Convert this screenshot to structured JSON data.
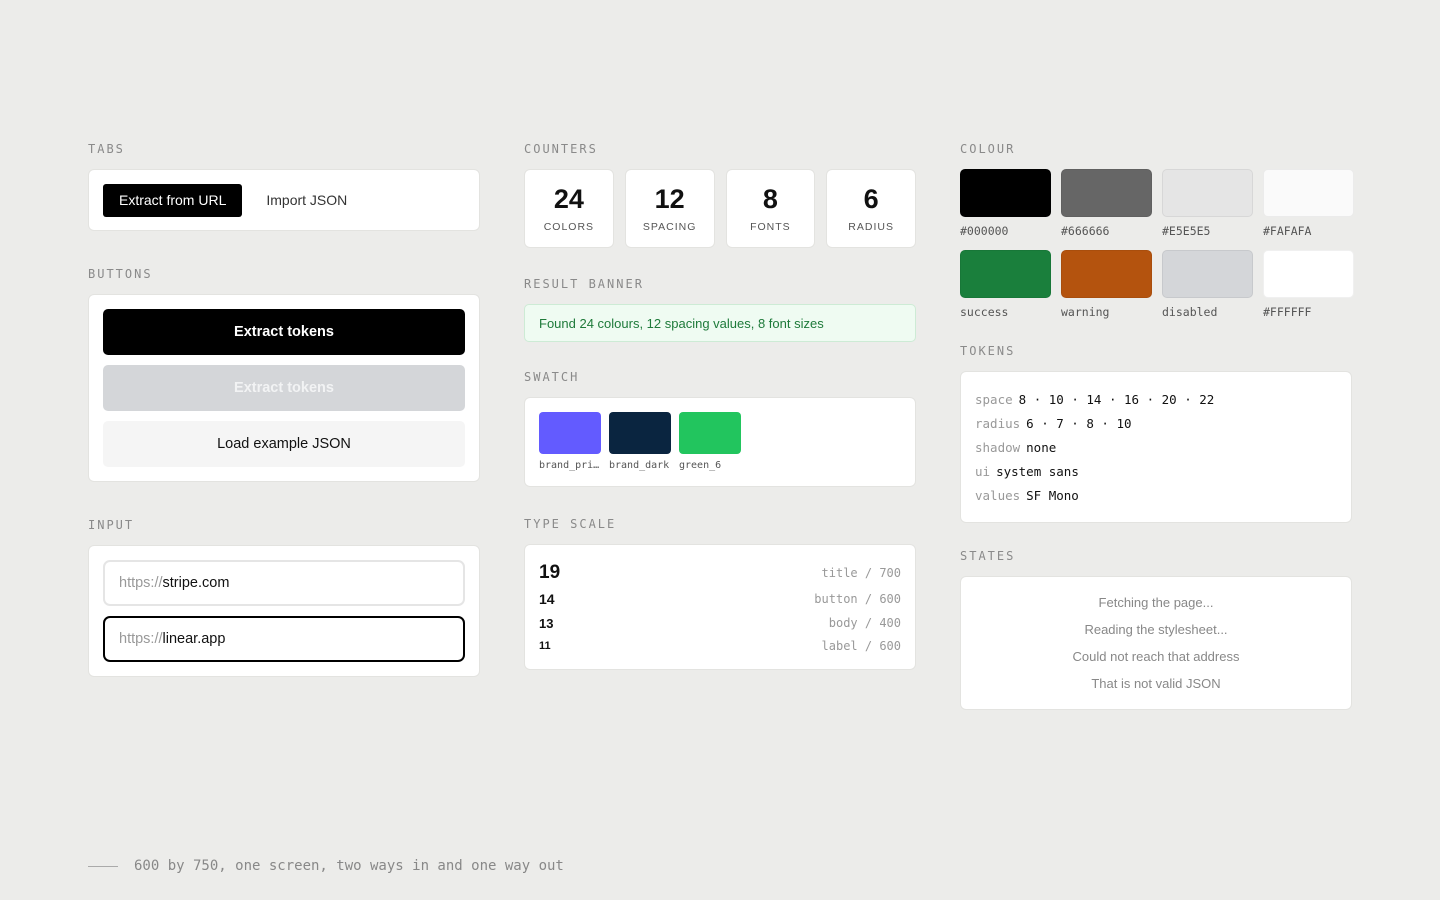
{
  "sections": {
    "tabs": "TABS",
    "buttons": "BUTTONS",
    "input": "INPUT",
    "counters": "COUNTERS",
    "result_banner": "RESULT BANNER",
    "swatch": "SWATCH",
    "type_scale": "TYPE SCALE",
    "colour": "COLOUR",
    "tokens": "TOKENS",
    "states": "STATES"
  },
  "tabs": {
    "active": "Extract from URL",
    "inactive": "Import JSON"
  },
  "buttons": {
    "primary": "Extract tokens",
    "disabled": "Extract tokens",
    "secondary": "Load example JSON"
  },
  "inputs": [
    {
      "prefix": "https://",
      "value": "stripe.com",
      "focused": false
    },
    {
      "prefix": "https://",
      "value": "linear.app",
      "focused": true
    }
  ],
  "counters": [
    {
      "value": "24",
      "label": "COLORS"
    },
    {
      "value": "12",
      "label": "SPACING"
    },
    {
      "value": "8",
      "label": "FONTS"
    },
    {
      "value": "6",
      "label": "RADIUS"
    }
  ],
  "banner": "Found 24 colours, 12 spacing values, 8 font sizes",
  "swatches": [
    {
      "name": "brand_pri…",
      "color": "#635BFF"
    },
    {
      "name": "brand_dark",
      "color": "#0A2540"
    },
    {
      "name": "green_6",
      "color": "#22C55E"
    }
  ],
  "type_scale": [
    {
      "size": "19",
      "meta": "title / 700"
    },
    {
      "size": "14",
      "meta": "button / 600"
    },
    {
      "size": "13",
      "meta": "body / 400"
    },
    {
      "size": "11",
      "meta": "label / 600"
    }
  ],
  "colours": [
    {
      "name": "#000000",
      "color": "#000000"
    },
    {
      "name": "#666666",
      "color": "#666666"
    },
    {
      "name": "#E5E5E5",
      "color": "#E5E5E5"
    },
    {
      "name": "#FAFAFA",
      "color": "#FAFAFA"
    },
    {
      "name": "success",
      "color": "#1A7F3C"
    },
    {
      "name": "warning",
      "color": "#B4530E"
    },
    {
      "name": "disabled",
      "color": "#D4D6D9"
    },
    {
      "name": "#FFFFFF",
      "color": "#FFFFFF"
    }
  ],
  "tokens": [
    {
      "key": "space",
      "value": "8 · 10 · 14 · 16 · 20 · 22"
    },
    {
      "key": "radius",
      "value": "6 · 7 · 8 · 10"
    },
    {
      "key": "shadow",
      "value": "none"
    },
    {
      "key": "ui",
      "value": "system sans"
    },
    {
      "key": "values",
      "value": "SF Mono"
    }
  ],
  "states": [
    "Fetching the page...",
    "Reading the stylesheet...",
    "Could not reach that address",
    "That is not valid JSON"
  ],
  "footer": "600 by 750, one screen, two ways in and one way out"
}
